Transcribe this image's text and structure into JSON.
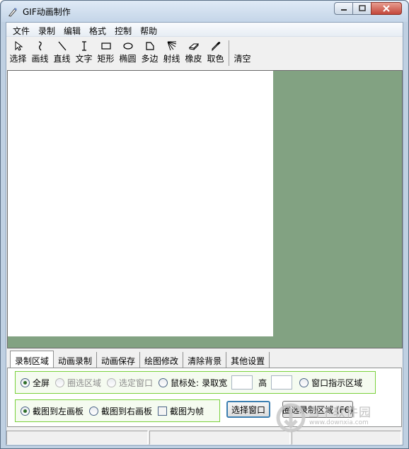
{
  "window": {
    "title": "GIF动画制作"
  },
  "menu": [
    "文件",
    "录制",
    "编辑",
    "格式",
    "控制",
    "帮助"
  ],
  "tools": [
    {
      "label": "选择",
      "icon": "cursor-icon"
    },
    {
      "label": "画线",
      "icon": "curve-icon"
    },
    {
      "label": "直线",
      "icon": "line-icon"
    },
    {
      "label": "文字",
      "icon": "text-cursor-icon"
    },
    {
      "label": "矩形",
      "icon": "rectangle-icon"
    },
    {
      "label": "椭圆",
      "icon": "ellipse-icon"
    },
    {
      "label": "多边",
      "icon": "polygon-icon"
    },
    {
      "label": "射线",
      "icon": "rays-icon"
    },
    {
      "label": "橡皮",
      "icon": "eraser-icon"
    },
    {
      "label": "取色",
      "icon": "eyedropper-icon"
    }
  ],
  "clear_label": "清空",
  "colors": {
    "canvas_bg": "#82a282",
    "group_border": "#7ad13c"
  },
  "tabs": [
    "录制区域",
    "动画录制",
    "动画保存",
    "绘图修改",
    "清除背景",
    "其他设置"
  ],
  "region": {
    "fullscreen": "全屏",
    "circle_region": "圈选区域",
    "select_window": "选定窗口",
    "mouse_at": "鼠标处:",
    "record_width": "录取宽",
    "height": "高",
    "window_indicator": "窗口指示区域"
  },
  "capture": {
    "to_left": "截图到左画板",
    "to_right": "截图到右画板",
    "as_frame": "截图为帧",
    "select_window_btn": "选择窗口",
    "circle_record_btn": "圈选录制区域 (F6)"
  },
  "watermark": {
    "text": "当下软件园",
    "url": "www.downxia.com"
  }
}
